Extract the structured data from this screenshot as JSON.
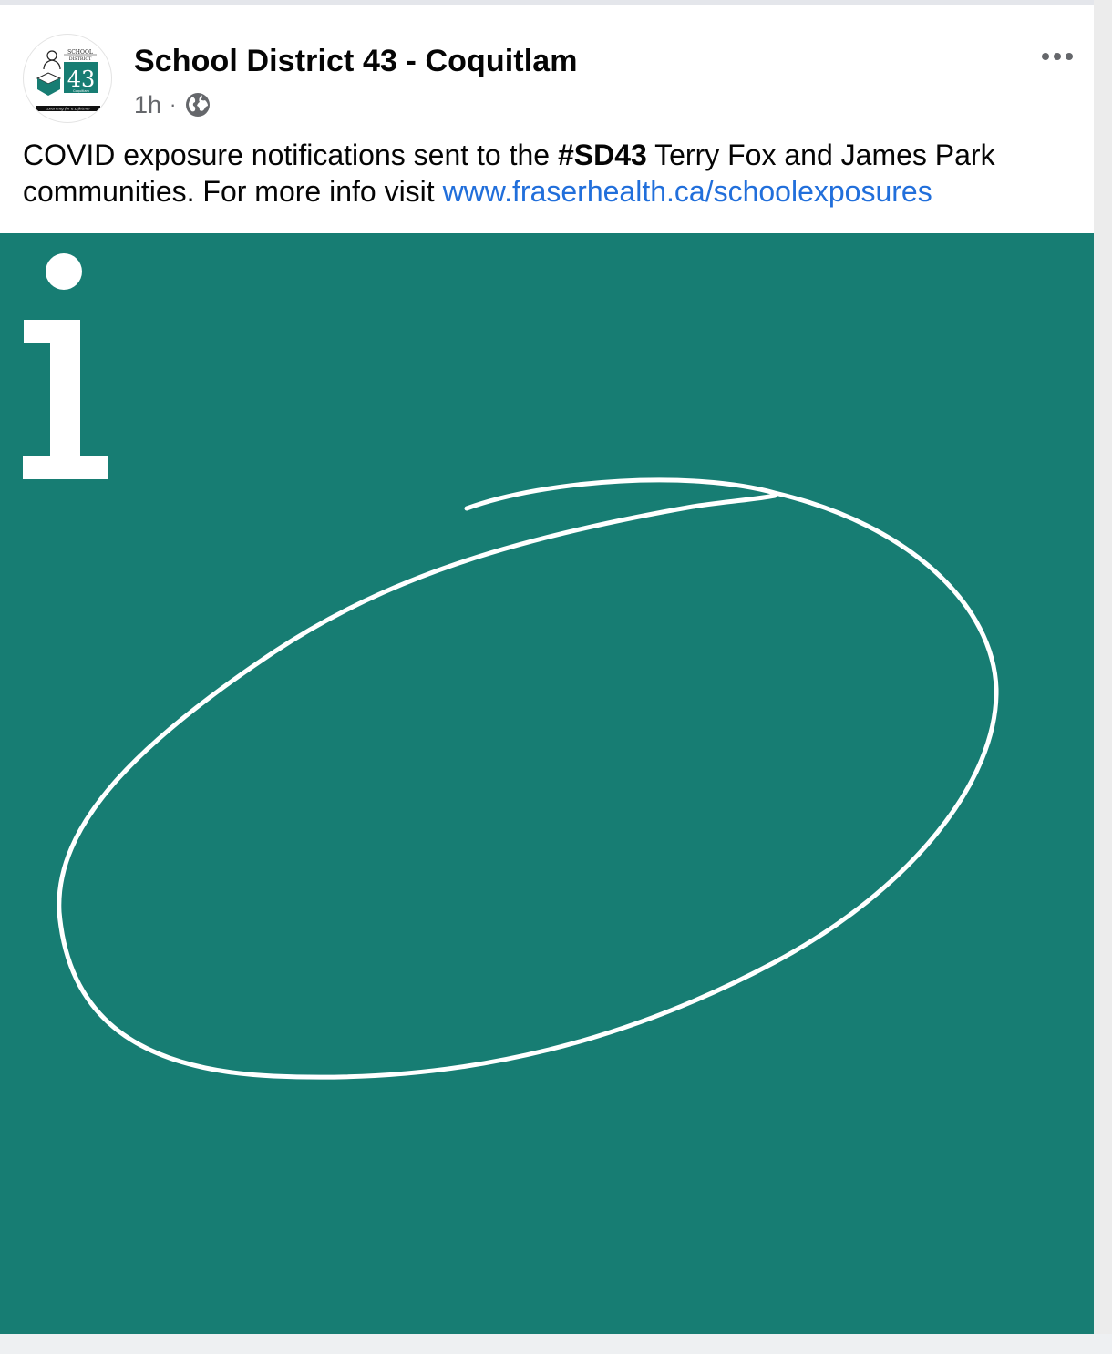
{
  "post": {
    "author": "School District 43 - Coquitlam",
    "timestamp": "1h",
    "separator": "·",
    "audience_icon": "globe-icon",
    "more_icon": "more-options-icon",
    "text": {
      "part1": "COVID exposure notifications sent to the ",
      "hashtag": "#SD43",
      "part2": " Terry Fox and James Park communities. For more info visit ",
      "link": "www.fraserhealth.ca/schoolexposures"
    }
  },
  "avatar_logo": {
    "line1": "SCHOOL",
    "line2": "DISTRICT",
    "number": "43",
    "city": "Coquitlam",
    "tagline": "Learning for a Lifetime"
  },
  "image": {
    "background": "#177d73",
    "icon": "info-icon",
    "glyph": "i"
  },
  "colors": {
    "link": "#216fdb",
    "text": "#050505",
    "secondary": "#65676b",
    "brand_teal": "#177d73"
  }
}
